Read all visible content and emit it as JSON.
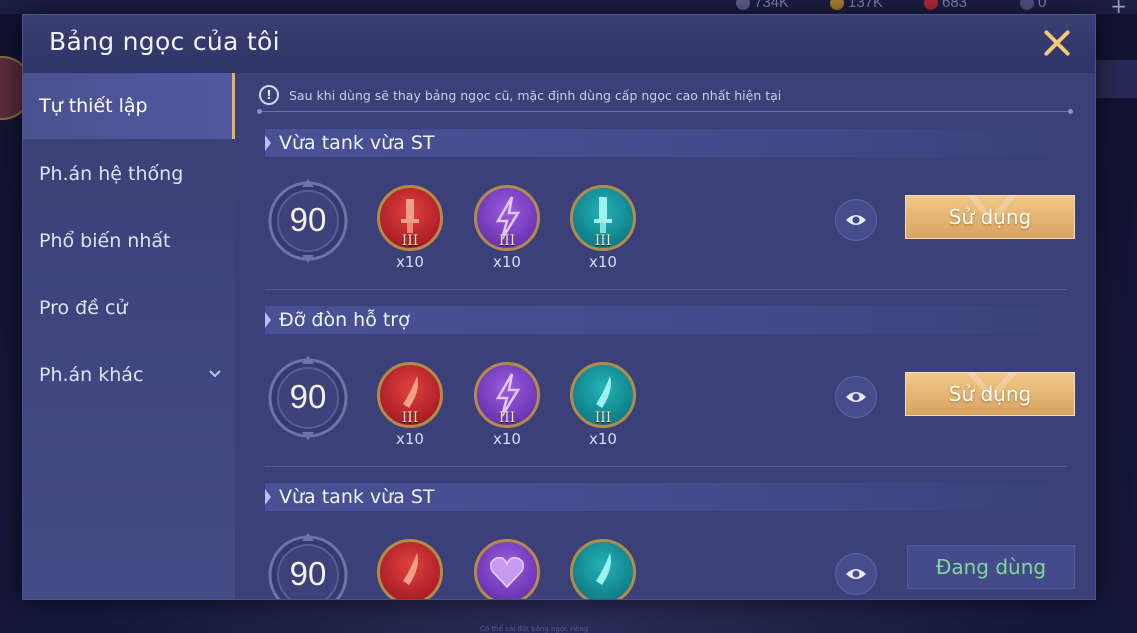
{
  "background": {
    "resources": [
      "734K",
      "137K",
      "683",
      "0"
    ],
    "bottom_text": "Có thể cài đặt bảng ngọc riêng"
  },
  "modal": {
    "title": "Bảng ngọc của tôi",
    "close_icon": "close-icon"
  },
  "sidebar": {
    "items": [
      {
        "label": "Tự thiết lập",
        "active": true
      },
      {
        "label": "Ph.án hệ thống",
        "active": false
      },
      {
        "label": "Phổ biến nhất",
        "active": false
      },
      {
        "label": "Pro đề cử",
        "active": false
      },
      {
        "label": "Ph.án khác",
        "active": false,
        "has_dropdown": true
      }
    ]
  },
  "notice": {
    "icon": "!",
    "text": "Sau khi dùng sẽ thay bảng ngọc cũ, mặc định dùng cấp ngọc cao nhất hiện tại"
  },
  "sets": [
    {
      "title": "Vừa tank vừa ST",
      "level": "90",
      "gems": [
        {
          "color": "red",
          "icon": "sword-icon",
          "tier": "III",
          "count": "x10"
        },
        {
          "color": "purple",
          "icon": "lightning-icon",
          "tier": "III",
          "count": "x10"
        },
        {
          "color": "teal",
          "icon": "sword-icon",
          "tier": "III",
          "count": "x10"
        }
      ],
      "button": "Sử dụng",
      "in_use": false
    },
    {
      "title": "Đỡ đòn hỗ trợ",
      "level": "90",
      "gems": [
        {
          "color": "red",
          "icon": "blade-icon",
          "tier": "III",
          "count": "x10"
        },
        {
          "color": "purple",
          "icon": "lightning-icon",
          "tier": "III",
          "count": "x10"
        },
        {
          "color": "teal",
          "icon": "blade-icon",
          "tier": "III",
          "count": "x10"
        }
      ],
      "button": "Sử dụng",
      "in_use": false
    },
    {
      "title": "Vừa tank vừa ST",
      "level": "90",
      "gems": [
        {
          "color": "red",
          "icon": "blade-icon"
        },
        {
          "color": "purple",
          "icon": "heart-icon"
        },
        {
          "color": "teal",
          "icon": "blade-icon"
        }
      ],
      "button": "Đang dùng",
      "in_use": true
    }
  ],
  "colors": {
    "accent_gold": "#e8b45a",
    "gem_red": "#c0262c",
    "gem_purple": "#7a3fc2",
    "gem_teal": "#12868f",
    "in_use_text": "#7ed89a"
  }
}
